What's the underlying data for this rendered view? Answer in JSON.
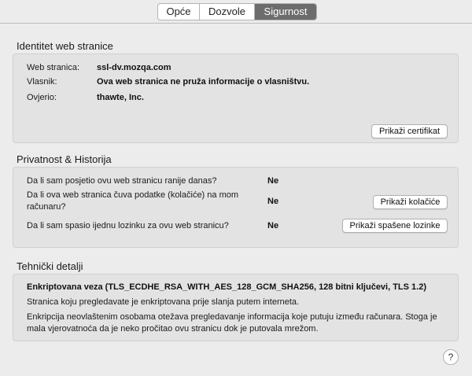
{
  "tabs": [
    {
      "label": "Opće"
    },
    {
      "label": "Dozvole"
    },
    {
      "label": "Sigurnost"
    }
  ],
  "identity": {
    "title": "Identitet web stranice",
    "website_label": "Web stranica:",
    "website_value": "ssl-dv.mozqa.com",
    "owner_label": "Vlasnik:",
    "owner_value": "Ova web stranica ne pruža informacije o vlasništvu.",
    "verified_label": "Ovjerio:",
    "verified_value": "thawte, Inc.",
    "view_cert_button": "Prikaži certifikat"
  },
  "privacy": {
    "title": "Privatnost & Historija",
    "q1": "Da li sam posjetio ovu web stranicu ranije danas?",
    "a1": "Ne",
    "q2_line1": "Da li ova web stranica čuva podatke (kolačiće) na mom",
    "q2_line2": "računaru?",
    "a2": "Ne",
    "view_cookies_button": "Prikaži kolačiće",
    "q3": "Da li sam spasio ijednu lozinku za ovu web stranicu?",
    "a3": "Ne",
    "view_passwords_button": "Prikaži spašene lozinke"
  },
  "tech": {
    "title": "Tehnički detalji",
    "heading": "Enkriptovana veza (TLS_ECDHE_RSA_WITH_AES_128_GCM_SHA256, 128 bitni ključevi, TLS 1.2)",
    "line1": "Stranica koju pregledavate je enkriptovana prije slanja putem interneta.",
    "line2a": "Enkripcija neovlaštenim osobama otežava pregledavanje informacija koje putuju između računara. Stoga je",
    "line2b": "mala vjerovatnoća da je neko pročitao ovu stranicu dok je putovala mrežom."
  },
  "help": {
    "label": "?"
  }
}
